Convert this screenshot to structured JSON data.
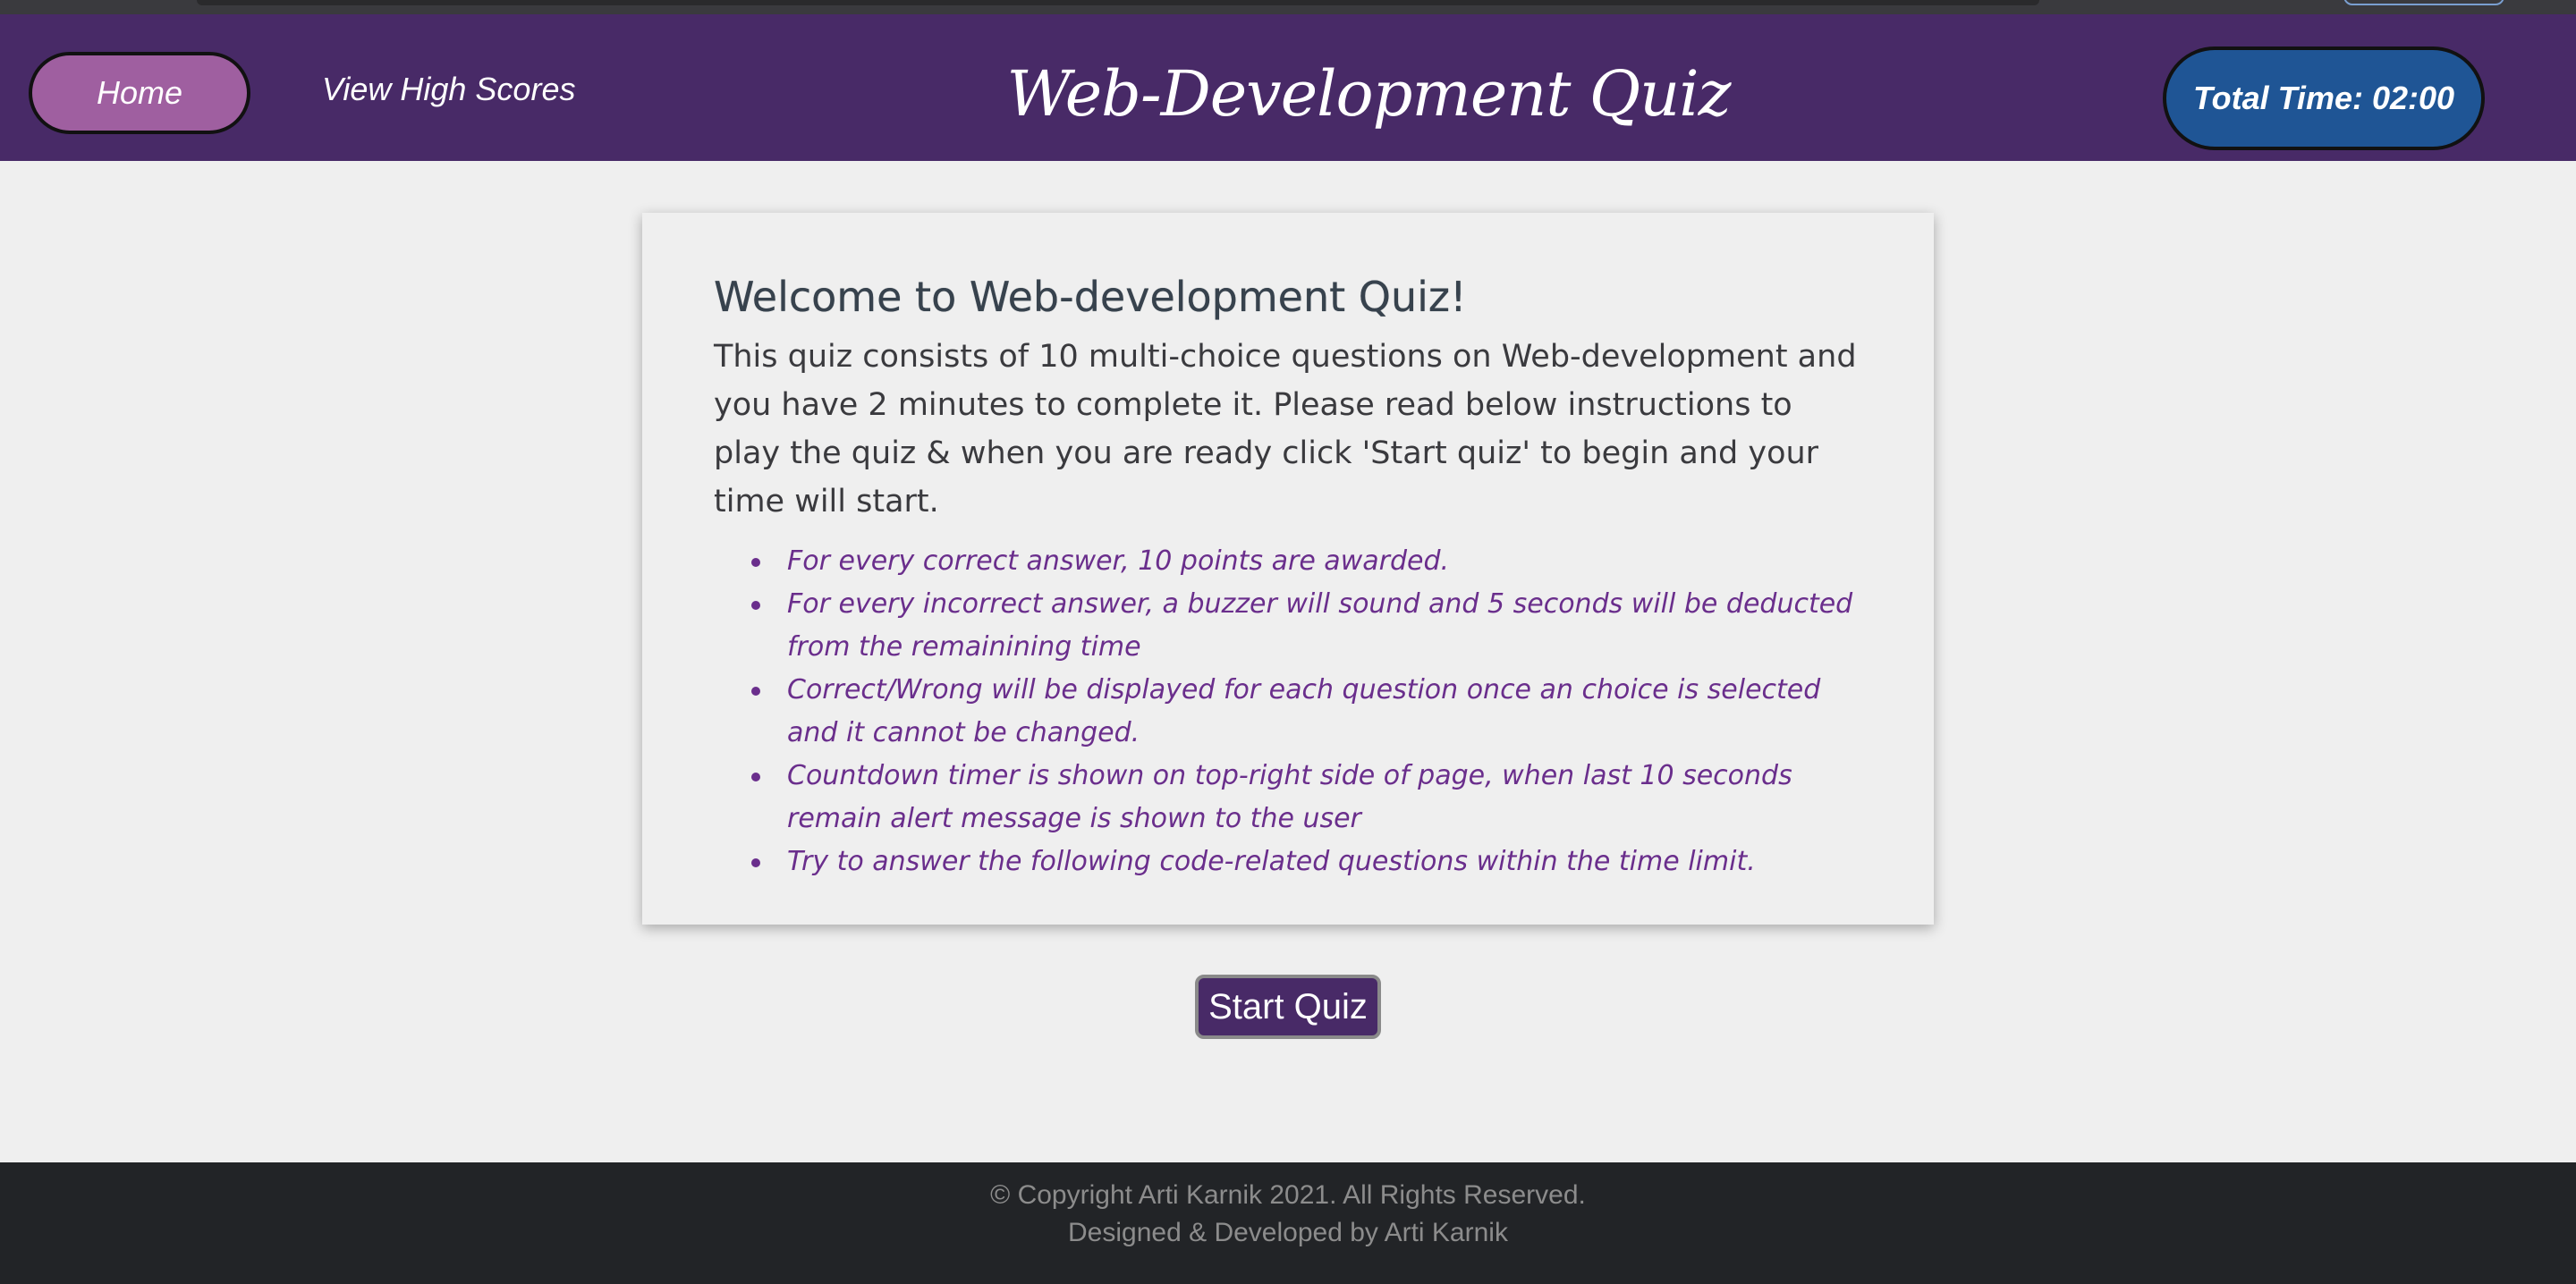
{
  "header": {
    "home_label": "Home",
    "high_scores_label": "View High Scores",
    "title": "Web-Development Quiz",
    "timer_text": "Total Time: 02:00"
  },
  "card": {
    "heading": "Welcome to Web-development Quiz!",
    "intro": "This quiz consists of 10 multi-choice questions on Web-development and you have 2 minutes to complete it. Please read below instructions to play the quiz & when you are ready click 'Start quiz' to begin and your time will start.",
    "rules": [
      "For every correct answer, 10 points are awarded.",
      "For every incorrect answer, a buzzer will sound and 5 seconds will be deducted from the remainining time",
      "Correct/Wrong will be displayed for each question once an choice is selected and it cannot be changed.",
      "Countdown timer is shown on top-right side of page, when last 10 seconds remain alert message is shown to the user",
      "Try to answer the following code-related questions within the time limit."
    ]
  },
  "start_button_label": "Start Quiz",
  "footer": {
    "copyright": "© Copyright Arti Karnik 2021. All Rights Reserved.",
    "credit": "Designed & Developed by Arti Karnik"
  },
  "colors": {
    "header_bg": "#482a67",
    "home_button": "#9f5fa0",
    "timer_bg": "#1f5595",
    "rule_text": "#6a2e8c",
    "footer_bg": "#222427"
  }
}
